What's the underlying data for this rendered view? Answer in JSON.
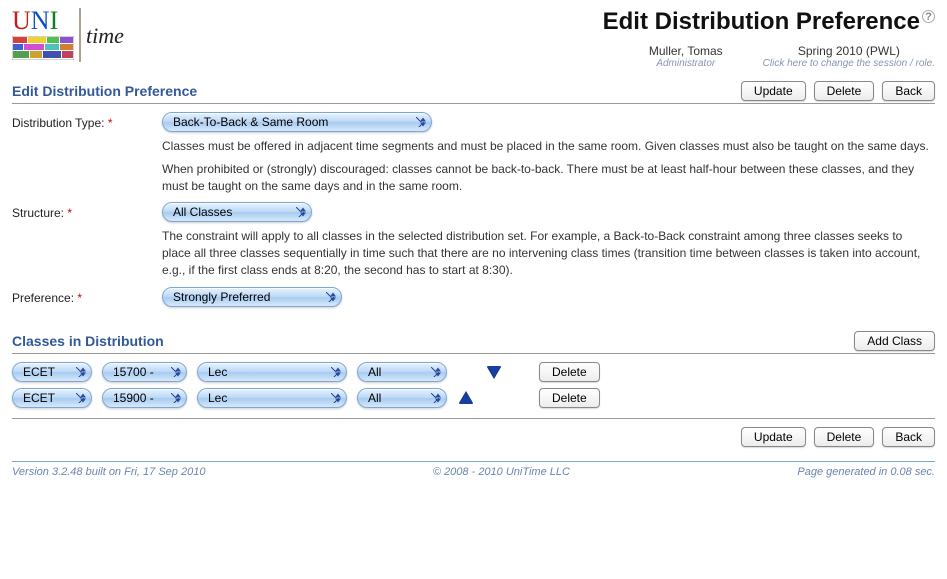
{
  "header": {
    "page_title": "Edit Distribution Preference",
    "user_name": "Muller, Tomas",
    "user_role": "Administrator",
    "session_name": "Spring 2010 (PWL)",
    "session_hint": "Click here to change the session / role."
  },
  "sections": {
    "edit_title": "Edit Distribution Preference",
    "classes_title": "Classes in Distribution"
  },
  "buttons": {
    "update": "Update",
    "delete": "Delete",
    "back": "Back",
    "add_class": "Add Class",
    "row_delete": "Delete"
  },
  "form": {
    "dist_type": {
      "label": "Distribution Type:",
      "value": "Back-To-Back & Same Room",
      "desc1": "Classes must be offered in adjacent time segments and must be placed in the same room. Given classes must also be taught on the same days.",
      "desc2": "When prohibited or (strongly) discouraged: classes cannot be back-to-back. There must be at least half-hour between these classes, and they must be taught on the same days and in the same room."
    },
    "structure": {
      "label": "Structure:",
      "value": "All Classes",
      "desc": "The constraint will apply to all classes in the selected distribution set. For example, a Back-to-Back constraint among three classes seeks to place all three classes sequentially in time such that there are no intervening class times (transition time between classes is taken into account, e.g., if the first class ends at 8:20, the second has to start at 8:30)."
    },
    "preference": {
      "label": "Preference:",
      "value": "Strongly Preferred"
    }
  },
  "classes": [
    {
      "subject": "ECET",
      "course": "15700 -",
      "type": "Lec",
      "sel": "All"
    },
    {
      "subject": "ECET",
      "course": "15900 -",
      "type": "Lec",
      "sel": "All"
    }
  ],
  "footer": {
    "left": "Version 3.2.48 built on Fri, 17 Sep 2010",
    "center": "© 2008 - 2010 UniTime LLC",
    "right": "Page generated in 0.08 sec."
  }
}
